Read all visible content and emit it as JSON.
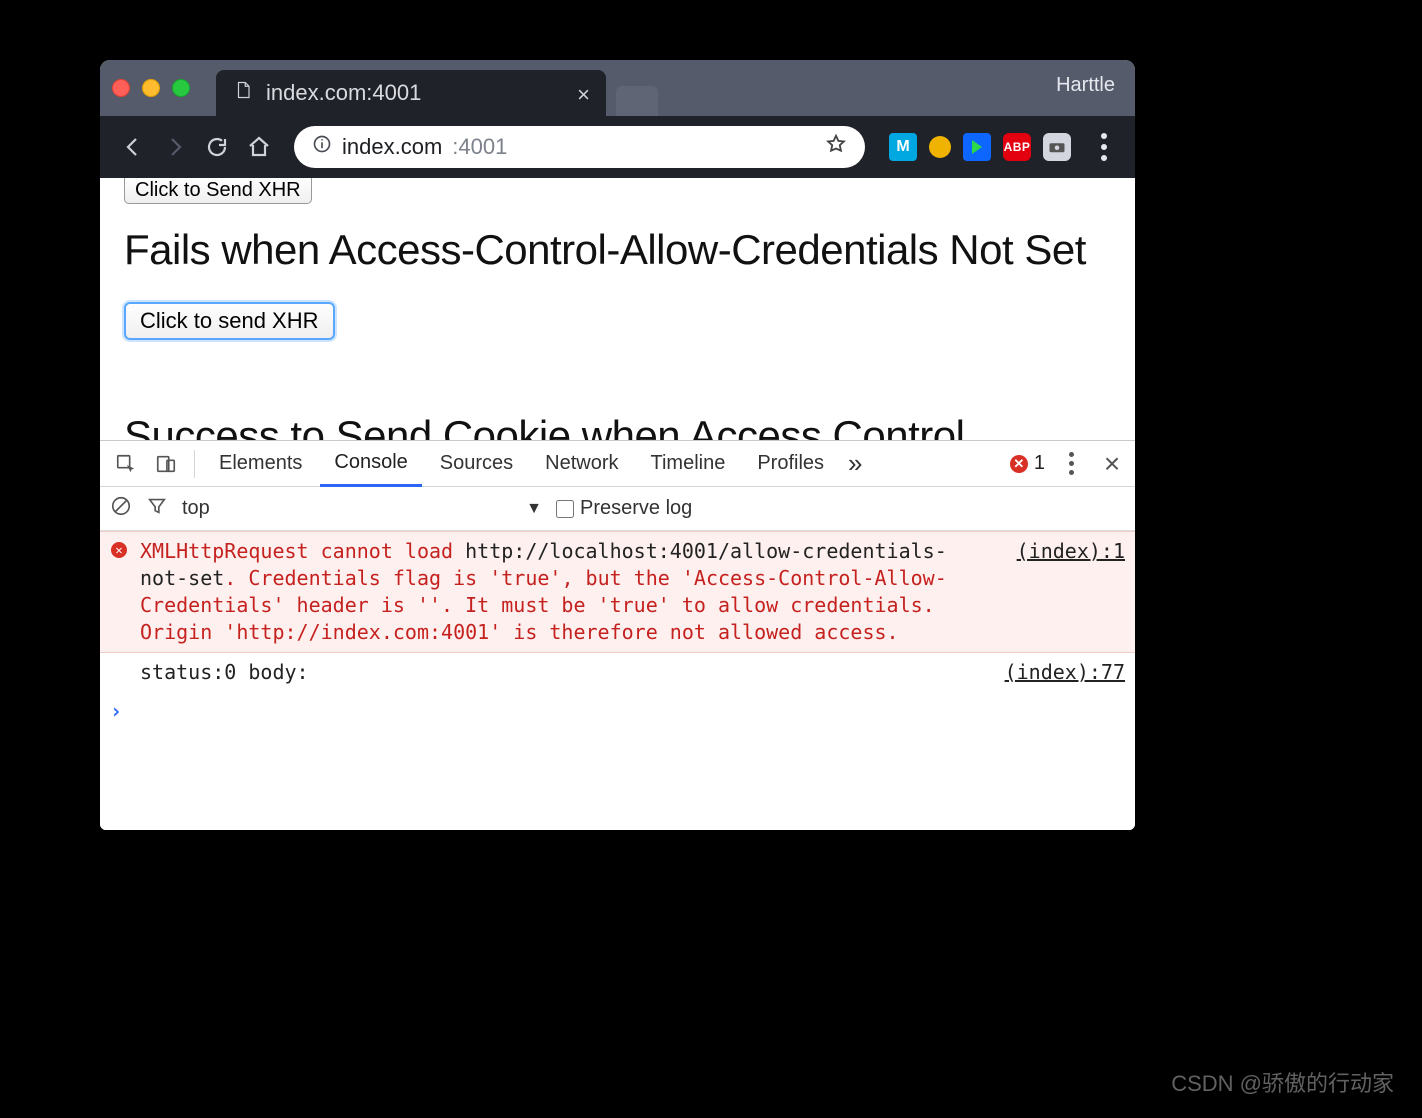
{
  "chrome": {
    "profile_name": "Harttle",
    "tab": {
      "title": "index.com:4001"
    },
    "address": {
      "host": "index.com",
      "port": ":4001"
    },
    "extensions": {
      "m_label": "M",
      "abp_label": "ABP"
    }
  },
  "page": {
    "button_top": "Click to Send XHR",
    "heading1": "Fails when Access-Control-Allow-Credentials Not Set",
    "button_focus": "Click to send XHR",
    "heading2_partial": "Success to Send Cookie when Access Control"
  },
  "devtools": {
    "tabs": {
      "elements": "Elements",
      "console": "Console",
      "sources": "Sources",
      "network": "Network",
      "timeline": "Timeline",
      "profiles": "Profiles"
    },
    "error_count": "1",
    "toolbar": {
      "context": "top",
      "preserve_log": "Preserve log"
    },
    "messages": {
      "error": {
        "prefix": "XMLHttpRequest cannot load ",
        "url": "http://localhost:4001/allow-credentials-not-set",
        "rest": ". Credentials flag is 'true', but the 'Access-Control-Allow-Credentials' header is ''. It must be 'true' to allow credentials. Origin 'http://index.com:4001' is therefore not allowed access.",
        "source": "(index):1"
      },
      "log": {
        "text": "status:0 body:",
        "source": "(index):77"
      }
    }
  },
  "watermark": "CSDN @骄傲的行动家"
}
